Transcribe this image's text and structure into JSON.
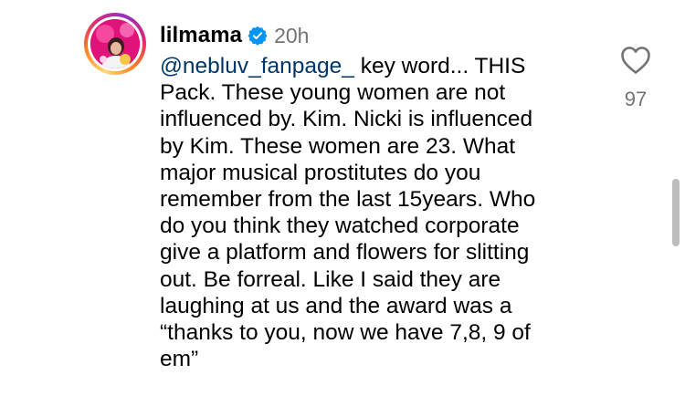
{
  "comment": {
    "username": "lilmama",
    "verified_icon": "verified-badge-icon",
    "timestamp": "20h",
    "mention": "@nebluv_fanpage_",
    "text_lines": [
      " key word... THIS",
      "Pack. These young women are not",
      "influenced by. Kim. Nicki is influenced",
      "by Kim. These women are 23. What",
      "major musical prostitutes do you",
      "remember from the last 15years. Who",
      "do you think they watched corporate",
      "give a platform and flowers for slitting",
      "out. Be forreal. Like I said they are",
      "laughing at us and the award was a",
      "“thanks to you, now we have 7,8, 9 of",
      "em”"
    ],
    "like_icon": "heart-outline-icon",
    "like_count": "97"
  },
  "colors": {
    "mention": "#00376b",
    "muted": "#737373",
    "verified": "#0095f6",
    "avatar_bg": "#e8157f"
  }
}
